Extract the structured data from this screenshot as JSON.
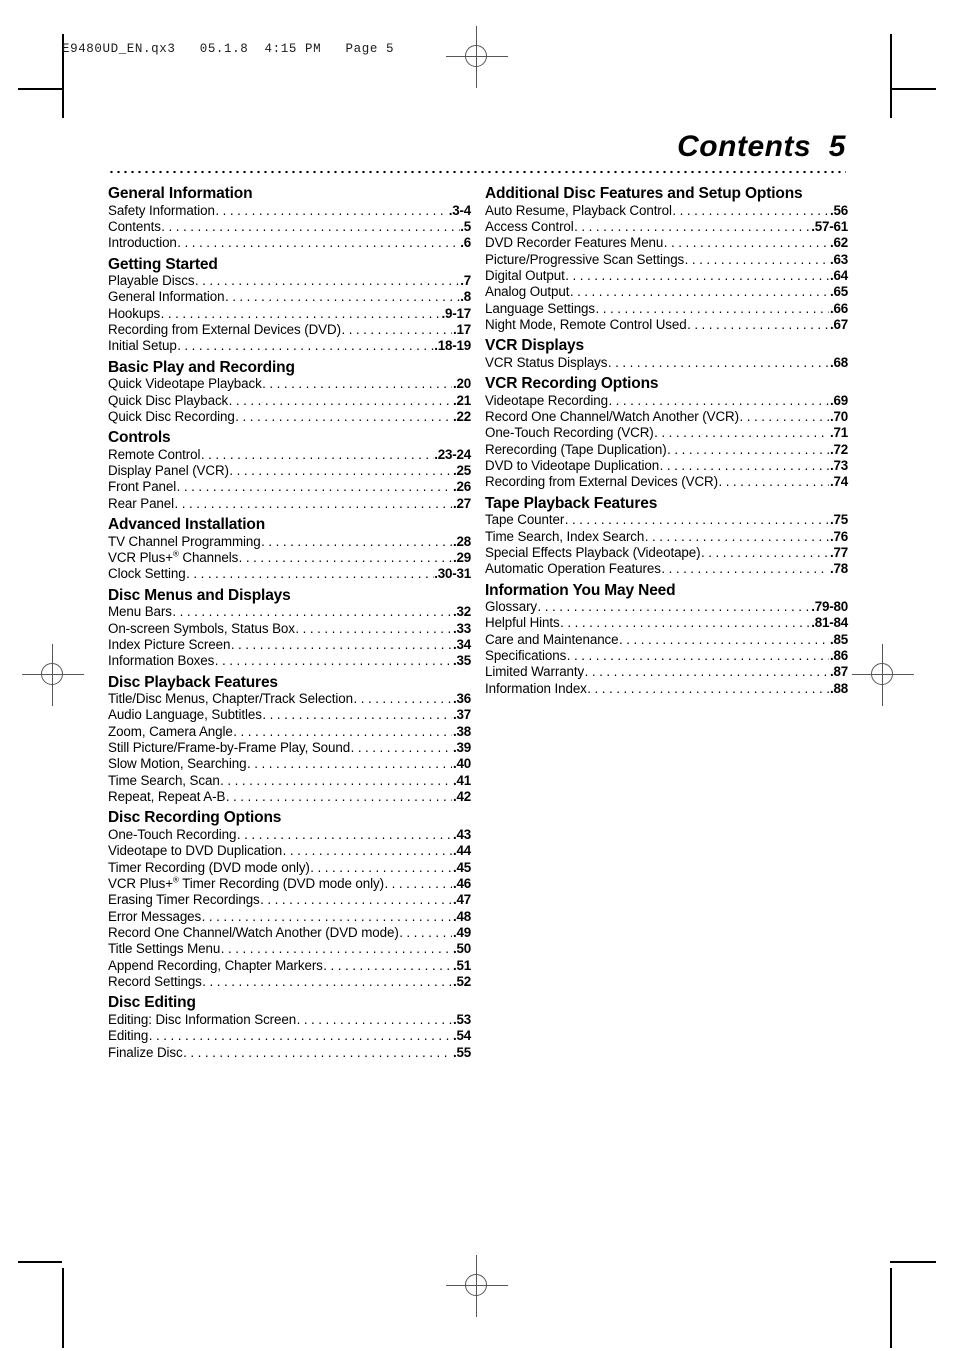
{
  "slug": "E9480UD_EN.qx3   05.1.8  4:15 PM   Page 5",
  "page_title": "Contents  5",
  "columns": [
    {
      "name": "left-column",
      "sections": [
        {
          "heading": "General Information",
          "entries": [
            {
              "label": "Safety Information",
              "page": "3-4"
            },
            {
              "label": "Contents",
              "page": "5"
            },
            {
              "label": "Introduction",
              "page": "6"
            }
          ]
        },
        {
          "heading": "Getting Started",
          "entries": [
            {
              "label": "Playable Discs",
              "page": "7"
            },
            {
              "label": "General Information",
              "page": "8"
            },
            {
              "label": "Hookups",
              "page": "9-17"
            },
            {
              "label": "Recording from External Devices (DVD)",
              "page": "17"
            },
            {
              "label": "Initial Setup",
              "page": "18-19"
            }
          ]
        },
        {
          "heading": "Basic Play and Recording",
          "entries": [
            {
              "label": "Quick Videotape Playback",
              "page": "20"
            },
            {
              "label": "Quick Disc Playback",
              "page": "21"
            },
            {
              "label": "Quick Disc Recording",
              "page": "22"
            }
          ]
        },
        {
          "heading": "Controls",
          "entries": [
            {
              "label": "Remote Control",
              "page": "23-24"
            },
            {
              "label": "Display Panel (VCR)",
              "page": "25"
            },
            {
              "label": "Front Panel",
              "page": "26"
            },
            {
              "label": "Rear Panel",
              "page": "27"
            }
          ]
        },
        {
          "heading": "Advanced Installation",
          "entries": [
            {
              "label": "TV Channel Programming",
              "page": "28"
            },
            {
              "label": "VCR Plus+® Channels",
              "page": "29",
              "has_reg": true,
              "label_pre": "VCR Plus+",
              "label_post": " Channels"
            },
            {
              "label": "Clock Setting",
              "page": "30-31"
            }
          ]
        },
        {
          "heading": "Disc Menus and Displays",
          "entries": [
            {
              "label": "Menu Bars",
              "page": "32"
            },
            {
              "label": "On-screen Symbols, Status Box",
              "page": "33"
            },
            {
              "label": "Index Picture Screen",
              "page": "34"
            },
            {
              "label": "Information Boxes",
              "page": "35"
            }
          ]
        },
        {
          "heading": "Disc Playback Features",
          "entries": [
            {
              "label": "Title/Disc Menus, Chapter/Track Selection",
              "page": "36"
            },
            {
              "label": "Audio Language, Subtitles",
              "page": "37"
            },
            {
              "label": "Zoom, Camera Angle",
              "page": "38"
            },
            {
              "label": "Still Picture/Frame-by-Frame Play, Sound",
              "page": "39"
            },
            {
              "label": "Slow Motion, Searching",
              "page": "40"
            },
            {
              "label": "Time Search, Scan",
              "page": "41"
            },
            {
              "label": "Repeat, Repeat A-B",
              "page": "42"
            }
          ]
        },
        {
          "heading": "Disc Recording Options",
          "entries": [
            {
              "label": "One-Touch Recording",
              "page": "43"
            },
            {
              "label": "Videotape to DVD Duplication",
              "page": "44"
            },
            {
              "label": "Timer Recording (DVD mode only)",
              "page": "45"
            },
            {
              "label": "VCR Plus+® Timer Recording (DVD mode only)",
              "page": "46",
              "has_reg": true,
              "label_pre": "VCR Plus+",
              "label_post": " Timer Recording (DVD mode only)"
            },
            {
              "label": "Erasing Timer Recordings",
              "page": "47"
            },
            {
              "label": "Error Messages",
              "page": "48"
            },
            {
              "label": "Record One Channel/Watch Another (DVD mode)",
              "page": "49"
            },
            {
              "label": "Title Settings Menu",
              "page": "50"
            },
            {
              "label": "Append Recording, Chapter Markers",
              "page": "51"
            },
            {
              "label": "Record Settings",
              "page": "52"
            }
          ]
        },
        {
          "heading": "Disc Editing",
          "entries": [
            {
              "label": "Editing: Disc Information Screen",
              "page": "53"
            },
            {
              "label": "Editing",
              "page": "54"
            },
            {
              "label": "Finalize Disc",
              "page": "55"
            }
          ]
        }
      ]
    },
    {
      "name": "right-column",
      "sections": [
        {
          "heading": "Additional Disc Features and Setup Options",
          "entries": [
            {
              "label": "Auto Resume, Playback Control",
              "page": "56"
            },
            {
              "label": "Access Control",
              "page": "57-61"
            },
            {
              "label": "DVD Recorder Features Menu",
              "page": "62"
            },
            {
              "label": "Picture/Progressive Scan Settings",
              "page": "63"
            },
            {
              "label": "Digital Output",
              "page": "64"
            },
            {
              "label": "Analog Output",
              "page": "65"
            },
            {
              "label": "Language Settings",
              "page": "66"
            },
            {
              "label": "Night Mode, Remote Control Used",
              "page": "67"
            }
          ]
        },
        {
          "heading": "VCR Displays",
          "entries": [
            {
              "label": "VCR Status Displays",
              "page": "68"
            }
          ]
        },
        {
          "heading": "VCR Recording Options",
          "entries": [
            {
              "label": "Videotape Recording",
              "page": "69"
            },
            {
              "label": "Record One Channel/Watch Another (VCR)",
              "page": "70"
            },
            {
              "label": "One-Touch Recording (VCR)",
              "page": "71"
            },
            {
              "label": "Rerecording (Tape Duplication)",
              "page": "72"
            },
            {
              "label": "DVD to Videotape Duplication",
              "page": "73"
            },
            {
              "label": "Recording from External Devices (VCR)",
              "page": "74"
            }
          ]
        },
        {
          "heading": "Tape Playback Features",
          "entries": [
            {
              "label": "Tape Counter",
              "page": "75"
            },
            {
              "label": "Time Search, Index Search",
              "page": "76"
            },
            {
              "label": "Special Effects Playback (Videotape)",
              "page": "77"
            },
            {
              "label": "Automatic Operation Features",
              "page": "78"
            }
          ]
        },
        {
          "heading": "Information You May Need",
          "entries": [
            {
              "label": "Glossary",
              "page": "79-80"
            },
            {
              "label": "Helpful Hints",
              "page": "81-84"
            },
            {
              "label": "Care and Maintenance",
              "page": "85"
            },
            {
              "label": "Specifications",
              "page": "86"
            },
            {
              "label": "Limited Warranty",
              "page": "87"
            },
            {
              "label": "Information Index",
              "page": "88"
            }
          ]
        }
      ]
    }
  ]
}
